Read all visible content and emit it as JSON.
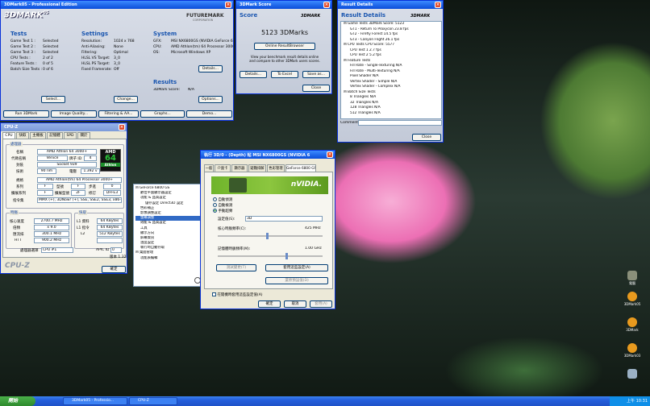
{
  "dmark": {
    "title": "3DMark05 - Professional Edition",
    "logo": "3DMARK",
    "logo_sup": "05",
    "brand": "FUTUREMARK",
    "brand_sub": "CORPORATION",
    "tests_h": "Tests",
    "settings_h": "Settings",
    "system_h": "System",
    "results_h": "Results",
    "tests": [
      [
        "Game Test 1 :",
        "Selected"
      ],
      [
        "Game Test 2 :",
        "Selected"
      ],
      [
        "Game Test 3 :",
        "Selected"
      ],
      [
        "CPU Tests :",
        "2 of 2"
      ],
      [
        "Feature Tests :",
        "0 of 5"
      ],
      [
        "Batch Size Tests :",
        "0 of 6"
      ]
    ],
    "settings": [
      [
        "Resolution:",
        "1024 x 768"
      ],
      [
        "Anti-Aliasing:",
        "None"
      ],
      [
        "Filtering:",
        "Optimal"
      ],
      [
        "HLSL VS Target:",
        "3_0"
      ],
      [
        "HLSL PS Target:",
        "3_0"
      ],
      [
        "Fixed Framerate:",
        "Off"
      ]
    ],
    "system": [
      [
        "GFX:",
        "MSI NX6800GS (NVIDIA GeForce 6800"
      ],
      [
        "CPU:",
        "AMD Athlon(tm) 64 Processor 3000+"
      ],
      [
        "OS:",
        "Microsoft Windows XP"
      ]
    ],
    "result": [
      "3DMark Score:",
      "N/A"
    ],
    "select_btn": "Select...",
    "change_btn": "Change...",
    "details_btn": "Details...",
    "options_btn": "Options...",
    "bottom_btns": [
      "Run 3DMark",
      "Image Quality...",
      "Filtering & AA...",
      "Graphs...",
      "Demo..."
    ]
  },
  "score": {
    "title": "3DMark Score",
    "header": "Score",
    "logo": "3DMARK",
    "value": "5123 3DMarks",
    "online_btn": "Online ResultBrowser",
    "msg": "View your benchmark result details online and compare to other 3DMark users scores.",
    "details_btn": "Details...",
    "excel_btn": "To Excel",
    "save_btn": "Save as...",
    "close_btn": "Close"
  },
  "result": {
    "title": "Result Details",
    "header": "Result Details",
    "logo": "3DMARK",
    "tree": [
      "Game Tests   3DMark Score: 5123",
      "GT1 - Return To Proxycon   23.8 fps",
      "GT2 - Firefly Forest   14.5 fps",
      "GT3 - Canyon Flight   26.1 fps",
      "CPU Tests   CPU Score: 5577",
      "CPU Test 1   2.7 fps",
      "CPU Test 2   5.2 fps",
      "Feature Tests",
      "Fill Rate - Single-Texturing   N/A",
      "Fill Rate - Multi-Texturing   N/A",
      "Pixel Shader   N/A",
      "Vertex Shader - Simple   N/A",
      "Vertex Shader - Complex   N/A",
      "Batch Size Tests",
      "8 Triangles   N/A",
      "32 Triangles   N/A",
      "128 Triangles   N/A",
      "512 Triangles   N/A"
    ],
    "comment_lbl": "Comment",
    "close_btn": "Close"
  },
  "cpuz": {
    "title": "CPU-Z",
    "tabs": [
      "CPU",
      "快取",
      "主機板",
      "記憶體",
      "SPD",
      "關於"
    ],
    "proc_h": "處理器",
    "name_l": "名稱",
    "name_v": "AMD Athlon 64 3000+",
    "code_l": "代碼名稱",
    "code_v": "Venice",
    "brand_l": "牌子 ID",
    "brand_v": "4",
    "pkg_l": "封裝",
    "pkg_v": "Socket 939",
    "tech_l": "技術",
    "tech_v": "90 nm",
    "volt_l": "電壓",
    "volt_v": "1.392 v",
    "spec_l": "規格",
    "spec_v": "AMD Athlon(tm) 64 Processor 3000+",
    "fam_l": "系列",
    "fam_v": "F",
    "model_l": "型號",
    "model_v": "F",
    "step_l": "步進",
    "step_v": "0",
    "efam_l": "擴展系列",
    "efam_v": "F",
    "emodel_l": "擴展型號",
    "emodel_v": "2F",
    "rev_l": "修訂",
    "rev_v": "DH-E3",
    "inst_l": "指令集",
    "inst_v": "MMX (+), 3DNow! (+), SSE, SSE2, SSE3, x86-64",
    "clk_h": "時脈",
    "core_l": "核心速度",
    "core_v": "2700.7 MHz",
    "mult_l": "倍頻",
    "mult_v": "x 9.0",
    "bus_l": "匯流排",
    "bus_v": "300.1 MHz",
    "htt_l": "HTT",
    "htt_v": "900.2 MHz",
    "cache_h": "快取",
    "l1d_l": "L1 資料",
    "l1d_v": "64 KBytes",
    "l1i_l": "L1 指令",
    "l1i_v": "64 KBytes",
    "l2_l": "L2",
    "l2_v": "512 KBytes",
    "sel_l": "處理器選擇",
    "sel_v": "CPU #1",
    "apic_l": "APIC ID",
    "apic_v": "0",
    "ver_v": "版本 1.32",
    "brand_logo": "CPU-Z",
    "ok_btn": "確定",
    "amd_logo": "AMD",
    "amd_64": "64",
    "athlon": "Athlon"
  },
  "nv": {
    "title": "執行 3D/0 - (Depth) 帖 MSI NX6800GS (NVIDIA 6",
    "tabs": [
      "一般",
      "介面卡",
      "顯示器",
      "疑難排解",
      "色彩管理",
      "GeForce 6800 GS"
    ],
    "tree": [
      "GeForce 6800 GS",
      "數位平面顯示器設定",
      "功能 & 品質設定",
      "儲存設定 Direct3D 設定",
      "色彩補正",
      "影像調整設定",
      "螢幕調整",
      "效能 & 品質設定",
      "工具",
      "顯示方向",
      "屏幕資訊",
      "溫度設定",
      "執行時自動存取",
      "桌面管理",
      "功能表編輯"
    ],
    "banner": "nVIDIA.",
    "r1": "自動偵測",
    "r2": "自動檢測",
    "r3": "手動超頻",
    "set_l": "設定值(S):",
    "set_v": "3D",
    "core_l": "核心時脈頻率(C):",
    "core_v": "425 MHz",
    "mem_l": "記憶體時脈頻率(M):",
    "mem_v": "1.00 GHz",
    "test_btn": "測試變更(T)",
    "apply_btn": "套用這些設定(A)",
    "restore_btn": "還原預設值(D)",
    "cb": "在開機時套用這些設定值(A)",
    "ok": "確定",
    "cancel": "取消",
    "apply": "套用(A)"
  },
  "desktop_icons": [
    "電腦",
    "3DMark05",
    "3DMark",
    "3DMark03"
  ],
  "taskbar": {
    "start": "開始",
    "tasks": [
      "3DMark05 - Professio...",
      "CPU-Z"
    ],
    "clock": "上午 10:31"
  }
}
